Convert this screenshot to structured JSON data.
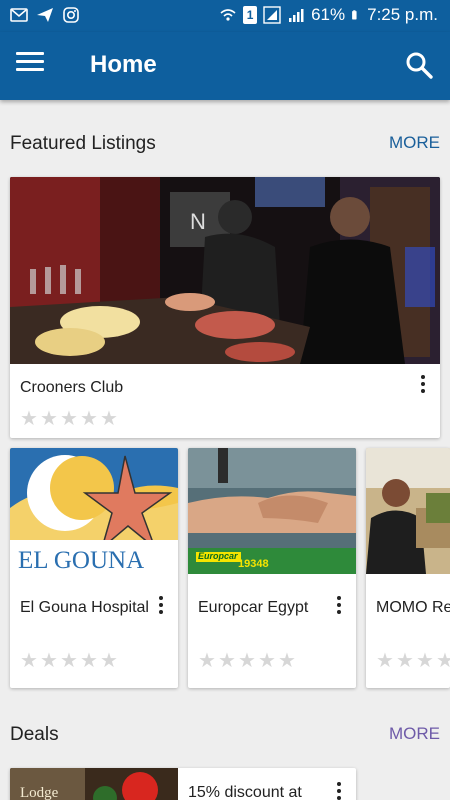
{
  "status_bar": {
    "battery": "61%",
    "time": "7:25 p.m.",
    "sim_badge": "1"
  },
  "app_bar": {
    "title": "Home"
  },
  "featured": {
    "title": "Featured Listings",
    "more_label": "MORE",
    "more_color": "#1a5f9a",
    "main_listing": {
      "name": "Crooners Club",
      "rating": 0
    },
    "listings": [
      {
        "name": "El Gouna Hospital",
        "rating": 0
      },
      {
        "name": "Europcar Egypt",
        "rating": 0,
        "image_text": "Europcar",
        "image_phone": "19348"
      },
      {
        "name": "MOMO Restaurant",
        "rating": 0
      }
    ]
  },
  "deals": {
    "title": "Deals",
    "more_label": "MORE",
    "more_color": "#6e5aa8",
    "items": [
      {
        "title": "15% discount at",
        "image_text": "Lodge"
      }
    ]
  },
  "colors": {
    "primary": "#0e5f9e",
    "star_empty": "#d7d7d7"
  }
}
